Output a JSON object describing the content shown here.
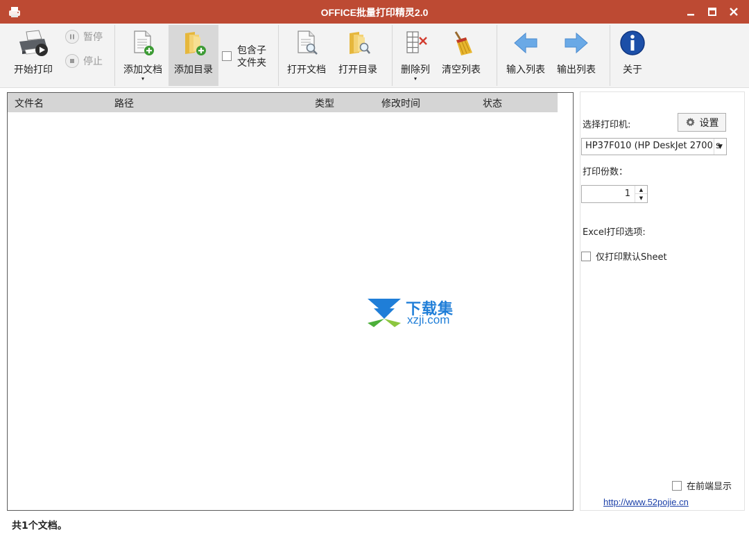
{
  "window": {
    "title": "OFFICE批量打印精灵2.0",
    "title_bar_color": "#bd4a33",
    "app_icon": "printer-app-icon",
    "controls": [
      "minimize-icon",
      "maximize-icon",
      "close-icon"
    ]
  },
  "toolbar": {
    "start_print": "开始打印",
    "pause": "暂停",
    "stop": "停止",
    "add_doc": "添加文档",
    "add_dir": "添加目录",
    "include_subfolders": "包含子文件夹",
    "open_doc": "打开文档",
    "open_dir": "打开目录",
    "delete_col": "删除列",
    "clear_list": "清空列表",
    "import_list": "输入列表",
    "export_list": "输出列表",
    "about": "关于",
    "dropdown_arrow": "▾"
  },
  "file_list": {
    "columns": [
      "文件名",
      "路径",
      "类型",
      "修改时间",
      "状态"
    ],
    "rows": []
  },
  "watermark": {
    "text_top": "下载集",
    "text_bottom": "xzji.com",
    "color": "#1f7ed8"
  },
  "panel": {
    "select_printer_label": "选择打印机:",
    "settings_label": "设置",
    "printer_value": "HP37F010 (HP DeskJet 2700 s",
    "copies_label": "打印份数：",
    "copies_value": "1",
    "excel_options_label": "Excel打印选项:",
    "only_default_sheet": "仅打印默认Sheet",
    "always_on_top": "在前端显示",
    "link": "http://www.52pojie.cn"
  },
  "status": {
    "text": "共1个文档。"
  }
}
